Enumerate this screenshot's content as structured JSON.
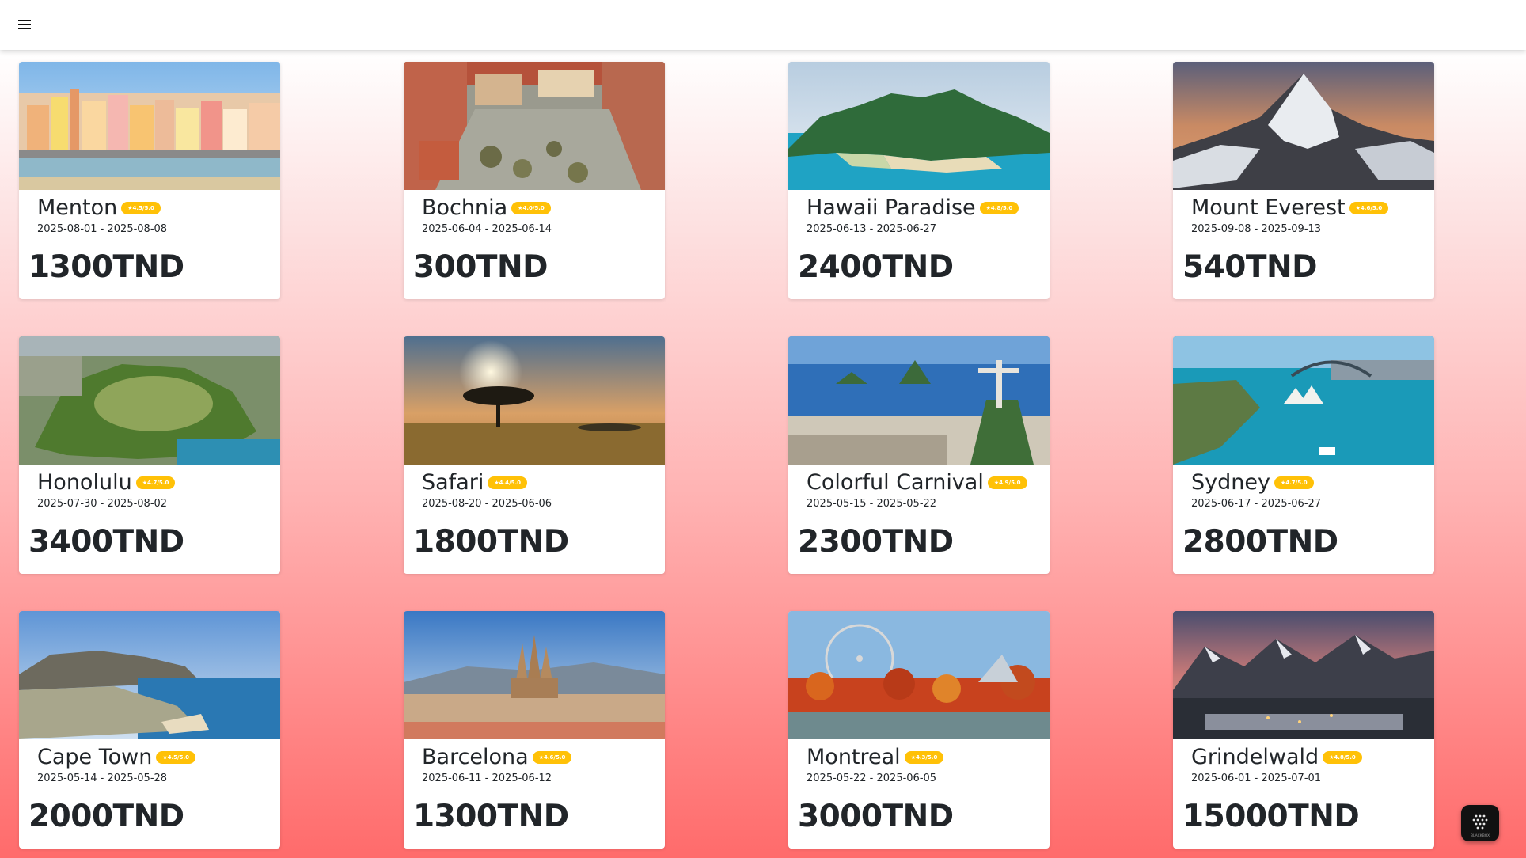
{
  "header": {
    "menu_icon": "hamburger-menu-icon"
  },
  "colors": {
    "rating_badge": "#ffc107",
    "gradient_top": "#ffffff",
    "gradient_bottom": "#ff6b6b",
    "text": "#212529"
  },
  "trips": [
    {
      "title": "Menton",
      "dates": "2025-08-01 - 2025-08-08",
      "price": "1300TND",
      "rating": "★4.5/5.0",
      "image": "menton-coastal-town-photo"
    },
    {
      "title": "Bochnia",
      "dates": "2025-06-04 - 2025-06-14",
      "price": "300TND",
      "rating": "★4.0/5.0",
      "image": "bochnia-town-square-photo"
    },
    {
      "title": "Hawaii Paradise",
      "dates": "2025-06-13 - 2025-06-27",
      "price": "2400TND",
      "rating": "★4.8/5.0",
      "image": "hawaii-coast-aerial-photo"
    },
    {
      "title": "Mount Everest",
      "dates": "2025-09-08 - 2025-09-13",
      "price": "540TND",
      "rating": "★4.6/5.0",
      "image": "mount-everest-peak-photo"
    },
    {
      "title": "Honolulu",
      "dates": "2025-07-30 - 2025-08-02",
      "price": "3400TND",
      "rating": "★4.7/5.0",
      "image": "honolulu-diamond-head-photo"
    },
    {
      "title": "Safari",
      "dates": "2025-08-20 - 2025-06-06",
      "price": "1800TND",
      "rating": "★4.4/5.0",
      "image": "safari-savanna-sunset-photo"
    },
    {
      "title": "Colorful Carnival",
      "dates": "2025-05-15 - 2025-05-22",
      "price": "2300TND",
      "rating": "★4.9/5.0",
      "image": "rio-de-janeiro-photo"
    },
    {
      "title": "Sydney",
      "dates": "2025-06-17 - 2025-06-27",
      "price": "2800TND",
      "rating": "★4.7/5.0",
      "image": "sydney-harbour-photo"
    },
    {
      "title": "Cape Town",
      "dates": "2025-05-14 - 2025-05-28",
      "price": "2000TND",
      "rating": "★4.5/5.0",
      "image": "cape-town-coast-photo"
    },
    {
      "title": "Barcelona",
      "dates": "2025-06-11 - 2025-06-12",
      "price": "1300TND",
      "rating": "★4.6/5.0",
      "image": "barcelona-sagrada-familia-photo"
    },
    {
      "title": "Montreal",
      "dates": "2025-05-22 - 2025-06-05",
      "price": "3000TND",
      "rating": "★4.3/5.0",
      "image": "montreal-autumn-photo"
    },
    {
      "title": "Grindelwald",
      "dates": "2025-06-01 - 2025-07-01",
      "price": "15000TND",
      "rating": "★4.8/5.0",
      "image": "grindelwald-alps-photo"
    }
  ],
  "widget": {
    "label": "BLACKBOX",
    "icon": "blackbox-ai-icon"
  }
}
